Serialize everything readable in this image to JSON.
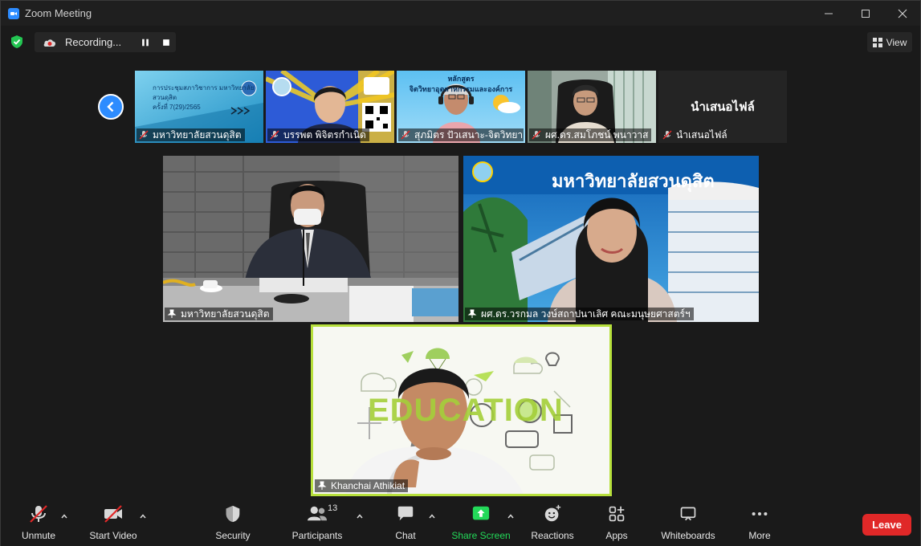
{
  "window": {
    "title": "Zoom Meeting"
  },
  "recording": {
    "label": "Recording..."
  },
  "view": {
    "label": "View"
  },
  "thumbnails": [
    {
      "name": "มหาวิทยาลัยสวนดุสิต",
      "slide_lines": [
        "การประชุมสภาวิชาการ มหาวิทยาลัยสวนดุสิต",
        "ครั้งที่ 7(29)/2565"
      ]
    },
    {
      "name": "บรรพต พิจิตรกำเนิด"
    },
    {
      "name": "สุภมิตร ปัวเสนาะ-จิตวิทยา...",
      "slide_lines": [
        "หลักสูตร",
        "จิตวิทยาอุตสาหกรรมและองค์การ"
      ]
    },
    {
      "name": "ผศ.ดร.สมโภชน์ พนาวาส"
    },
    {
      "name": "นำเสนอไฟล์",
      "center_text": "นำเสนอไฟล์"
    }
  ],
  "tiles": [
    {
      "name": "มหาวิทยาลัยสวนดุสิต"
    },
    {
      "name": "ผศ.ดร.วรกมล วงษ์สถาปนาเลิศ คณะมนุษยศาสตร์ฯ",
      "banner": "มหาวิทยาลัยสวนดุสิต"
    },
    {
      "name": "Khanchai Athikiat",
      "background_word": "EDUCATION"
    }
  ],
  "toolbar": {
    "unmute": "Unmute",
    "start_video": "Start Video",
    "security": "Security",
    "participants": "Participants",
    "participants_count": "13",
    "chat": "Chat",
    "share_screen": "Share Screen",
    "reactions": "Reactions",
    "apps": "Apps",
    "whiteboards": "Whiteboards",
    "more": "More",
    "leave": "Leave"
  },
  "colors": {
    "accent": "#2d8cff",
    "share_green": "#23d959",
    "leave_red": "#e02828",
    "active_speaker": "#b7e03c"
  }
}
